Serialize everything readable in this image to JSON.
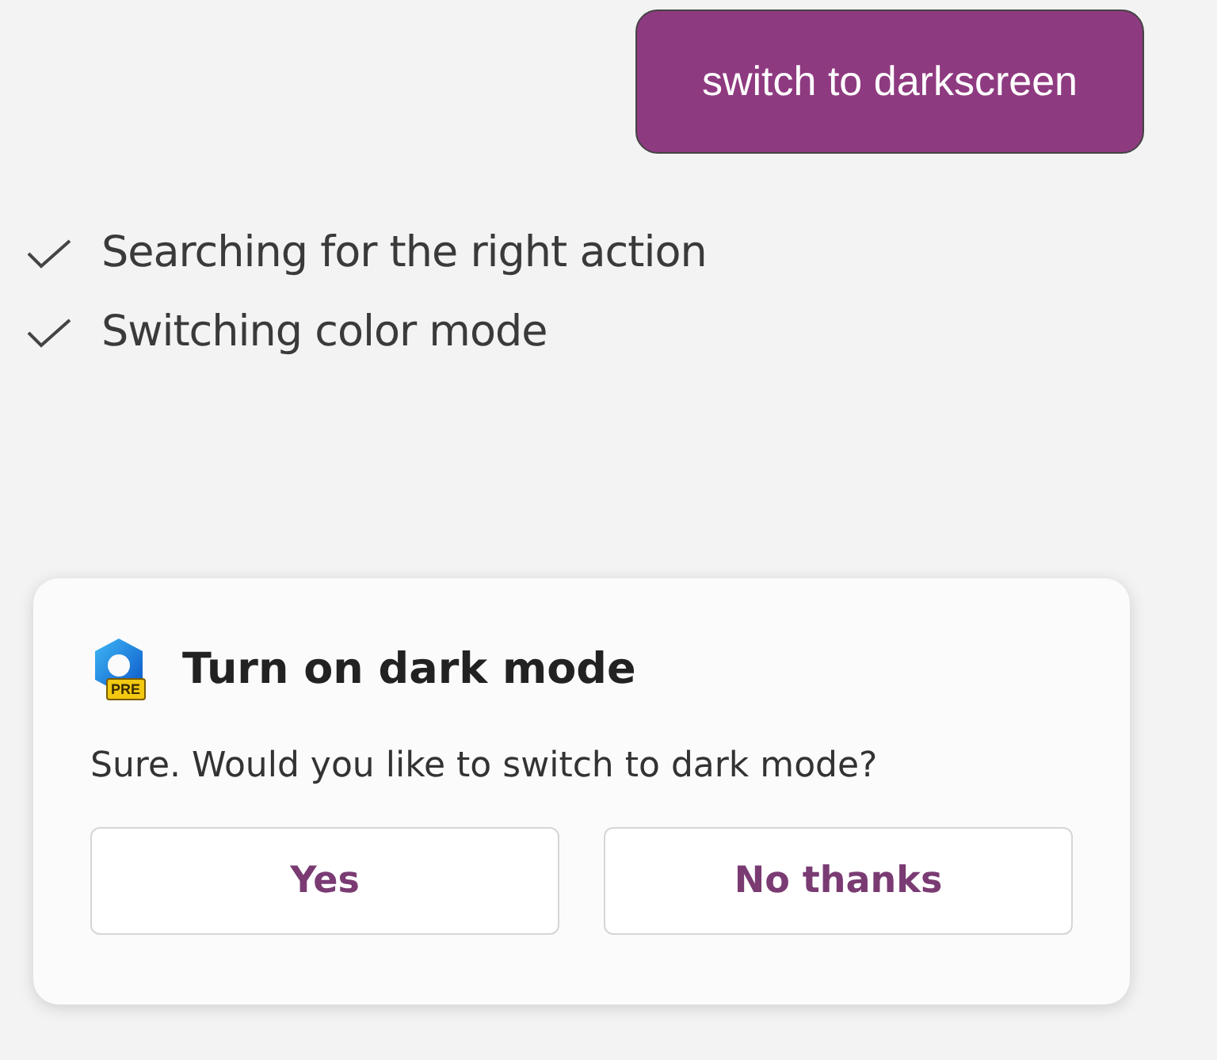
{
  "user_message": "switch to darkscreen",
  "steps": [
    {
      "label": "Searching for the right action",
      "done": true
    },
    {
      "label": "Switching color mode",
      "done": true
    }
  ],
  "card": {
    "title": "Turn on dark mode",
    "badge": "PRE",
    "message": "Sure. Would you like to switch to dark mode?",
    "buttons": [
      "Yes",
      "No thanks"
    ]
  }
}
